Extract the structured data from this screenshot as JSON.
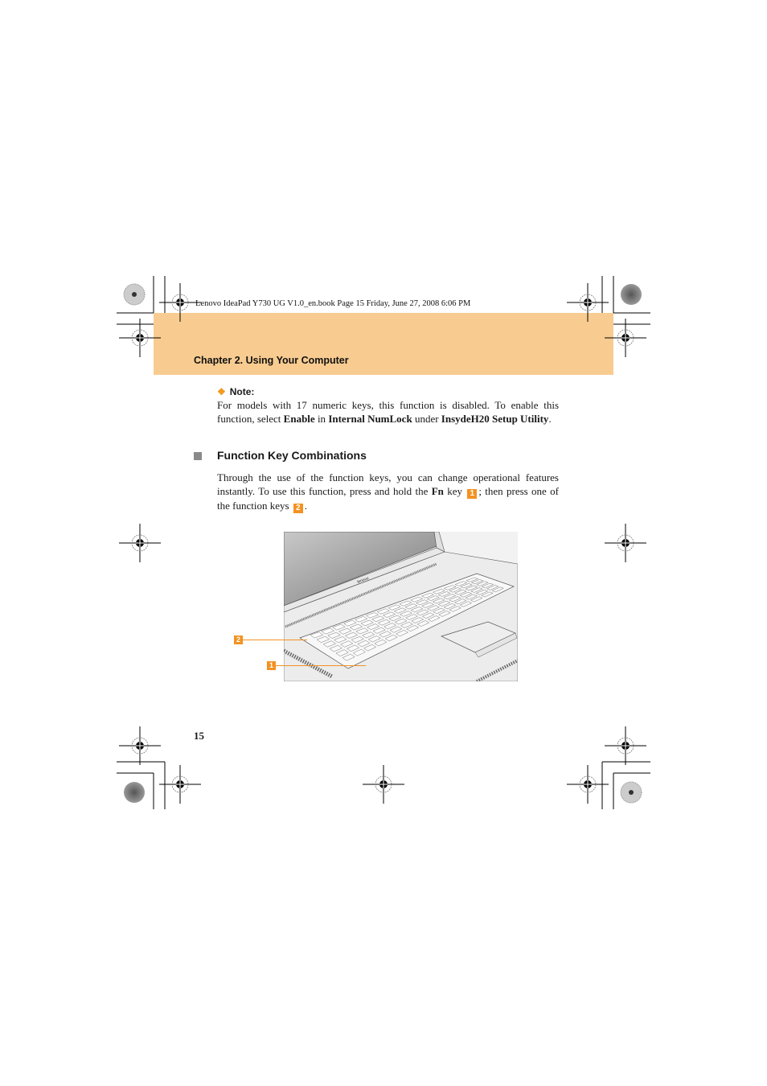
{
  "header": {
    "book_info": "Lenovo IdeaPad Y730 UG V1.0_en.book  Page 15  Friday, June 27, 2008  6:06 PM",
    "chapter": "Chapter 2. Using Your Computer",
    "band_color": "#f8cc90"
  },
  "note": {
    "icon": "diamond-cluster-icon",
    "label": "Note:",
    "text_parts": [
      {
        "t": "For models with 17 numeric keys, this function is disabled. To enable this function, select ",
        "b": false
      },
      {
        "t": "Enable",
        "b": true
      },
      {
        "t": " in ",
        "b": false
      },
      {
        "t": "Internal NumLock",
        "b": true
      },
      {
        "t": " under ",
        "b": false
      },
      {
        "t": "InsydeH20 Setup Utility",
        "b": true
      },
      {
        "t": ".",
        "b": false
      }
    ]
  },
  "section": {
    "bullet_icon": "square-bullet-icon",
    "title": "Function Key Combinations",
    "text_parts": [
      {
        "t": "Through the use of the function keys, you can change operational features instantly. To use this function, press and hold the ",
        "b": false
      },
      {
        "t": "Fn",
        "b": true
      },
      {
        "t": " key ",
        "b": false
      },
      {
        "badge": "1"
      },
      {
        "t": "; then press one of the function keys ",
        "b": false
      },
      {
        "badge": "2"
      },
      {
        "t": ".",
        "b": false
      }
    ]
  },
  "illustration": {
    "description": "laptop-keyboard-illustration",
    "callouts": [
      {
        "label": "2",
        "target": "function-keys"
      },
      {
        "label": "1",
        "target": "fn-key"
      }
    ],
    "accent_color": "#f39221"
  },
  "footer": {
    "page_number": "15"
  }
}
